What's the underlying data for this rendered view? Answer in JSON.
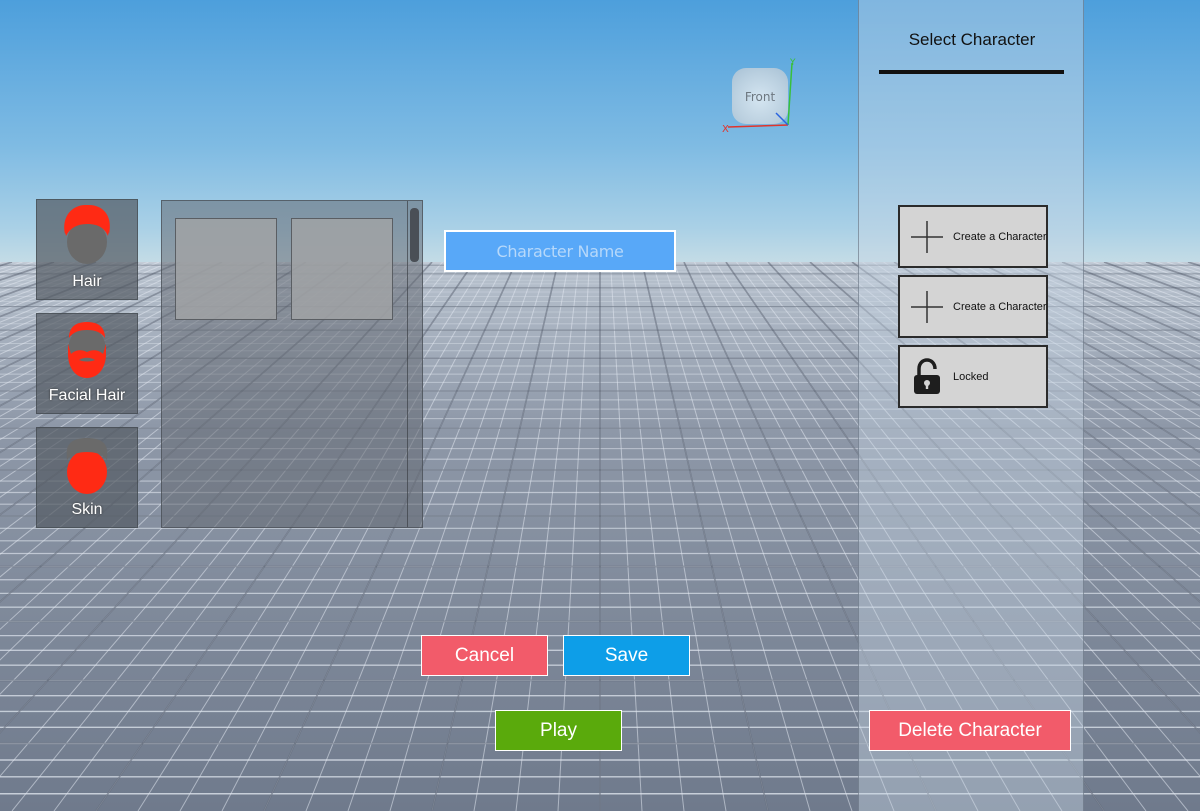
{
  "viewport": {
    "cube_label": "Front",
    "axis_x": "X",
    "axis_y": "Y"
  },
  "categories": [
    {
      "label": "Hair",
      "icon": "hair-icon"
    },
    {
      "label": "Facial Hair",
      "icon": "facial-hair-icon"
    },
    {
      "label": "Skin",
      "icon": "skin-icon"
    }
  ],
  "name_input": {
    "placeholder": "Character Name",
    "value": ""
  },
  "buttons": {
    "cancel": "Cancel",
    "save": "Save",
    "play": "Play",
    "delete": "Delete Character"
  },
  "sidebar": {
    "title": "Select Character",
    "slots": [
      {
        "label": "Create a Character",
        "icon": "plus-icon"
      },
      {
        "label": "Create a Character",
        "icon": "plus-icon"
      },
      {
        "label": "Locked",
        "icon": "lock-icon"
      }
    ]
  },
  "colors": {
    "accent_red": "#f25b6a",
    "accent_blue": "#0d9ee8",
    "accent_green": "#5aaa0c",
    "input_blue": "#58a8f8",
    "icon_red": "#ff2a14"
  }
}
